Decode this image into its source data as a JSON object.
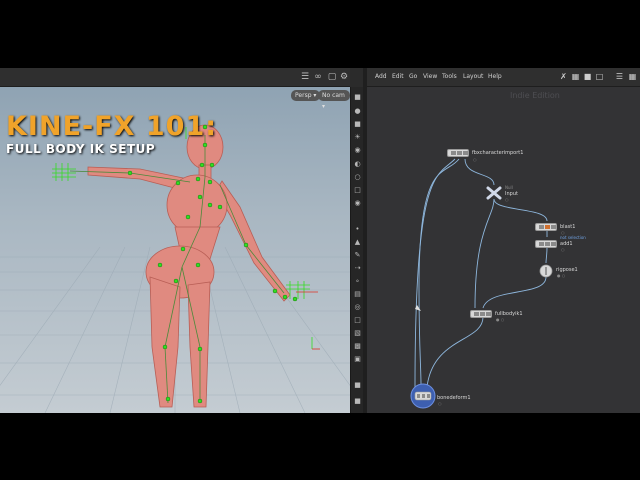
{
  "overlay": {
    "title": "KINE-FX 101:",
    "subtitle": "FULL BODY IK SETUP"
  },
  "viewport": {
    "persp_label": "Persp ▾",
    "cam_label": "No cam ▾"
  },
  "network": {
    "menu": [
      "Add",
      "Edit",
      "Go",
      "View",
      "Tools",
      "Layout",
      "Help"
    ],
    "edition": "Indie Edition",
    "nodes": {
      "character_import": {
        "label": "fbxcharacterimport1"
      },
      "input": {
        "label": "Input",
        "type": "Null"
      },
      "blast": {
        "label": "blast1",
        "sub": "not selection"
      },
      "add": {
        "label": "add1"
      },
      "rigpose": {
        "label": "rigpose1"
      },
      "fullbodyik": {
        "label": "fullbodyik1"
      },
      "bonedeform": {
        "label": "bonedeform1"
      }
    }
  },
  "colors": {
    "title": "#f0a32a",
    "body": "#e08a80",
    "joint": "#33dd22",
    "wire": "#8eb7dd"
  }
}
